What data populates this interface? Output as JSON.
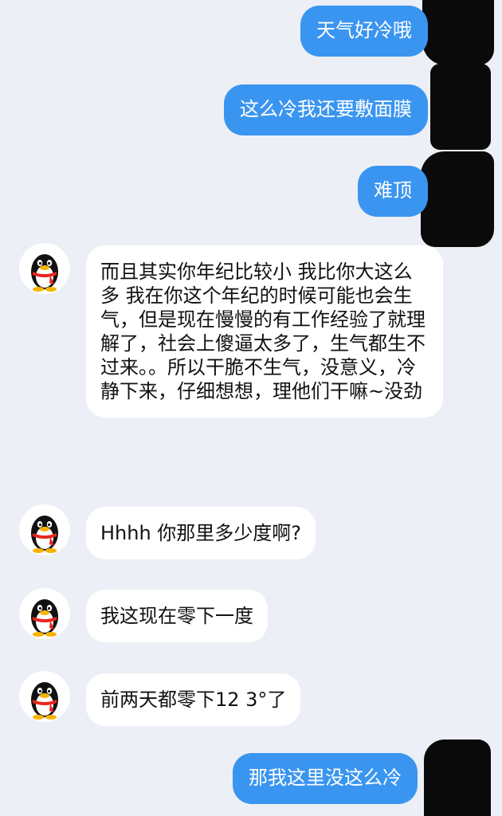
{
  "messages": [
    {
      "side": "out",
      "text": "天气好冷哦"
    },
    {
      "side": "out",
      "text": "这么冷我还要敷面膜"
    },
    {
      "side": "out",
      "text": "难顶"
    },
    {
      "side": "in",
      "text": "而且其实你年纪比较小 我比你大这么多 我在你这个年纪的时候可能也会生气，但是现在慢慢的有工作经验了就理解了，社会上傻逼太多了，生气都生不过来。。所以干脆不生气，没意义，冷静下来，仔细想想，理他们干嘛~没劲"
    },
    {
      "side": "in",
      "text": "Hhhh 你那里多少度啊?"
    },
    {
      "side": "in",
      "text": "我这现在零下一度"
    },
    {
      "side": "in",
      "text": "前两天都零下12 3°了"
    },
    {
      "side": "out",
      "text": "那我这里没这么冷"
    }
  ],
  "avatar_icon": "qq-penguin-icon",
  "colors": {
    "background": "#eceff5",
    "outgoing_bubble": "#3a95f0",
    "incoming_bubble": "#ffffff",
    "redaction": "#0a0a0a"
  }
}
